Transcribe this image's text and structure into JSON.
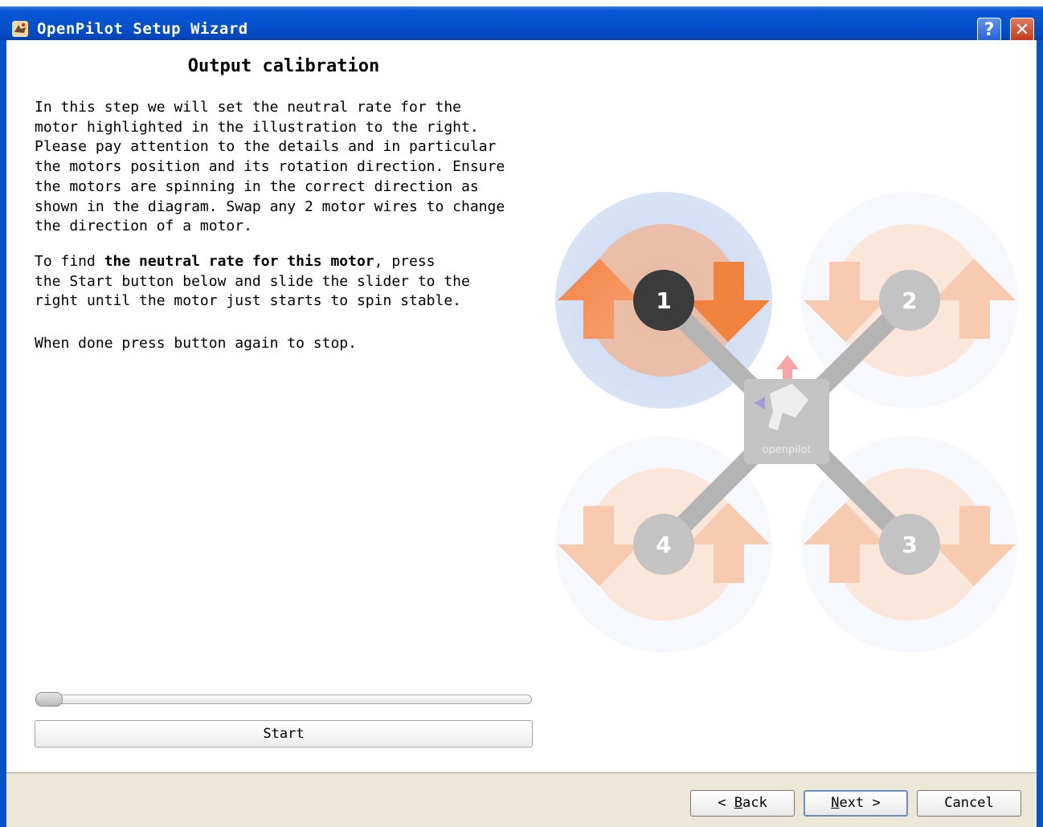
{
  "window": {
    "title": "OpenPilot Setup Wizard",
    "help_label": "?",
    "close_label": "✕"
  },
  "page": {
    "title": "Output calibration",
    "para1": "In this step we will set the neutral rate for the\nmotor highlighted in the illustration to the right.\nPlease pay attention to the details and in particular\nthe motors position and its rotation direction. Ensure\nthe motors are spinning in the correct direction as\nshown in the diagram. Swap any 2 motor wires to change\nthe direction of a motor.",
    "para2_prefix": "To find ",
    "para2_bold": "the neutral rate for this motor",
    "para2_suffix": ", press\nthe Start button below and slide the slider to the\nright until the motor just starts to spin stable.",
    "para3": "When done press button again to stop.",
    "slider_value": 0,
    "start_label": "Start"
  },
  "diagram": {
    "motors": [
      "1",
      "2",
      "3",
      "4"
    ],
    "highlighted_motor": "1",
    "logo_text": "openpilot",
    "colors": {
      "arrow": "#f08a4b",
      "highlight_ring": "#b4c7e8",
      "motor_active": "#3b3b3b",
      "motor_inactive": "#bdbdbd",
      "front_arrow": "#f6a6a6"
    }
  },
  "footer": {
    "back_u": "B",
    "back_rest": "ack",
    "next_u": "N",
    "next_rest": "ext >",
    "cancel_label": "Cancel"
  }
}
